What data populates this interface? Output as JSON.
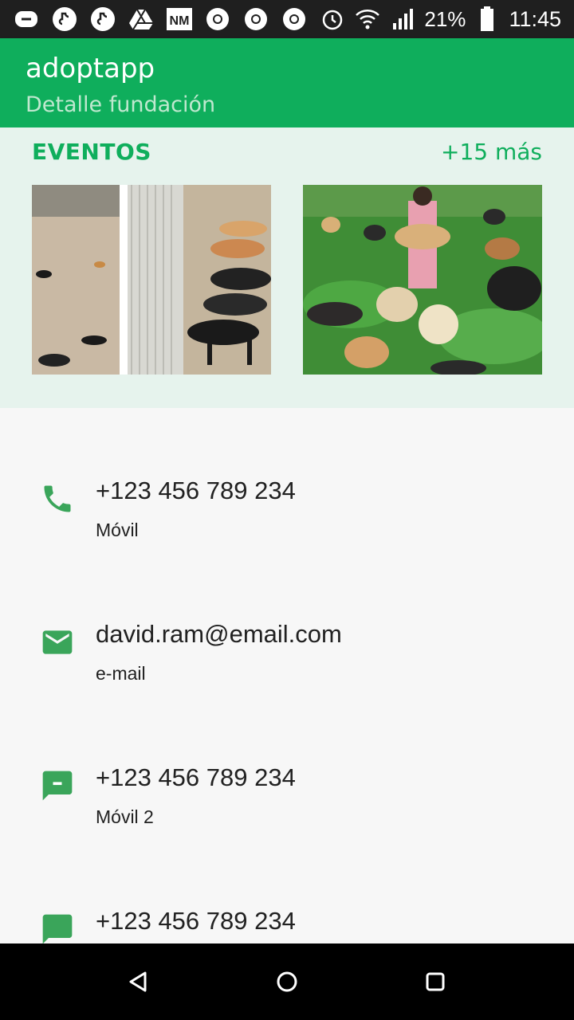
{
  "status_bar": {
    "battery": "21%",
    "time": "11:45",
    "icons": [
      "whatsapp-icon",
      "tiktok-icon",
      "tiktok-icon",
      "drive-icon",
      "nm-icon",
      "chrome-icon",
      "chrome-icon",
      "chrome-icon",
      "alarm-icon",
      "wifi-icon",
      "signal-icon",
      "battery-icon"
    ]
  },
  "app_bar": {
    "title": "adoptapp",
    "subtitle": "Detalle fundación"
  },
  "events": {
    "title": "EVENTOS",
    "more": "+15 más"
  },
  "contacts": [
    {
      "value": "+123 456 789 234",
      "label": "Móvil",
      "icon": "phone-icon"
    },
    {
      "value": "david.ram@email.com",
      "label": "e-mail",
      "icon": "email-icon"
    },
    {
      "value": "+123 456 789 234",
      "label": "Móvil 2",
      "icon": "sms-icon"
    },
    {
      "value": "+123 456 789 234",
      "label": "",
      "icon": "chat-icon"
    }
  ],
  "colors": {
    "primary": "#0fae5c",
    "accent_icon": "#3aa55a",
    "status_bar": "#1f1f1f",
    "events_bg": "#e6f3ed"
  }
}
